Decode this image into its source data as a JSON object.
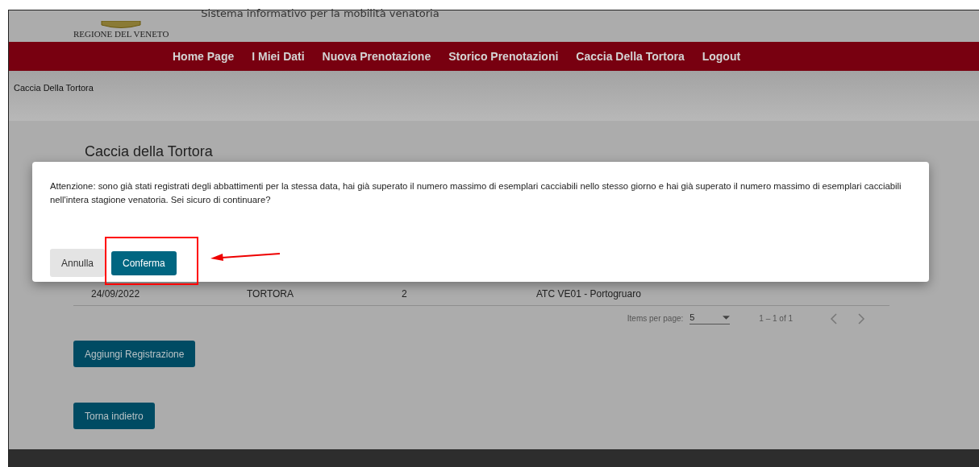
{
  "header": {
    "region": "REGIONE DEL VENETO",
    "subtitle": "Sistema informativo per la mobilità venatoria"
  },
  "nav": [
    {
      "label": "Home Page"
    },
    {
      "label": "I Miei Dati"
    },
    {
      "label": "Nuova Prenotazione"
    },
    {
      "label": "Storico Prenotazioni"
    },
    {
      "label": "Caccia Della Tortora"
    },
    {
      "label": "Logout"
    }
  ],
  "breadcrumb": "Caccia Della Tortora",
  "page_title": "Caccia della Tortora",
  "table": {
    "rows": [
      [
        "24/09/2022",
        "TORTORA",
        "2",
        "ATC VE01 - Portogruaro"
      ]
    ]
  },
  "paginator": {
    "label": "Items per page:",
    "page_size": "5",
    "range": "1 – 1 of 1"
  },
  "buttons": [
    "Aggiungi Registrazione",
    "Torna indietro"
  ],
  "dialog": {
    "message": "Attenzione: sono già stati registrati degli abbattimenti per la stessa data, hai già superato il numero massimo di esemplari cacciabili nello stesso giorno e hai già superato il numero massimo di esemplari cacciabili nell'intera stagione venatoria. Sei sicuro di continuare?",
    "buttons": [
      {
        "label": "Annulla",
        "kind": "secondary"
      },
      {
        "label": "Conferma",
        "kind": "primary"
      }
    ]
  }
}
